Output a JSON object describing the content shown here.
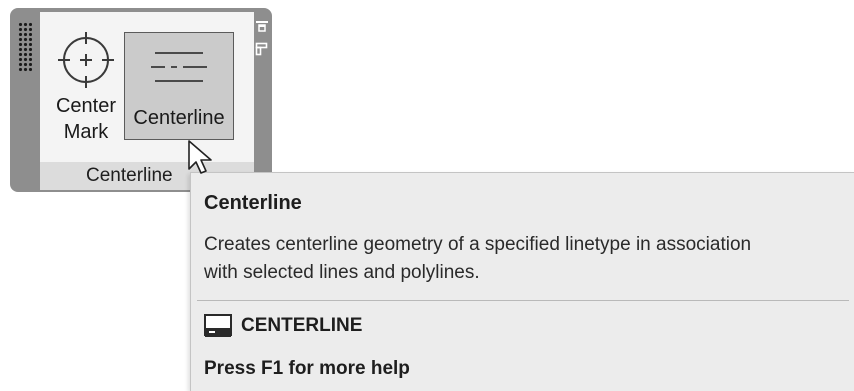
{
  "panel": {
    "title": "Centerline",
    "pin_icon": "pin-icon",
    "expand_icon": "panel-expand-icon",
    "grip_icon": "panel-grip-icon",
    "buttons": [
      {
        "id": "center-mark",
        "label_lines": [
          "Center",
          "Mark"
        ],
        "icon": "center-mark-icon"
      },
      {
        "id": "centerline",
        "label": "Centerline",
        "icon": "centerline-icon",
        "state": "hover"
      }
    ]
  },
  "tooltip": {
    "title": "Centerline",
    "description_lines": [
      "Creates centerline geometry of a specified linetype in association",
      "with selected lines and polylines."
    ],
    "command_icon": "command-line-icon",
    "command": "CENTERLINE",
    "help": "Press F1 for more help"
  },
  "cursor": {
    "icon": "mouse-pointer-icon"
  },
  "colors": {
    "panel_frame": "#8e8e8e",
    "panel_body": "#f4f4f4",
    "panel_footer": "#dcdcdc",
    "button_hover": "#cbcbcb",
    "tooltip_bg": "#ececec"
  }
}
